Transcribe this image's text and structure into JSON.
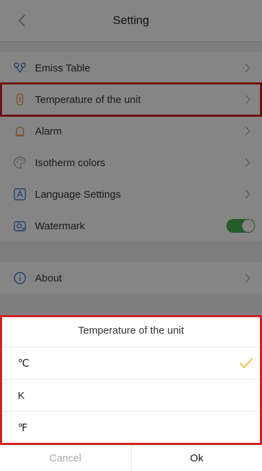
{
  "header": {
    "title": "Setting",
    "back_icon": "chevron-left-icon"
  },
  "settings": {
    "items": [
      {
        "label": "Emiss Table",
        "icon": "emissivity-icon",
        "trailing": "chevron"
      },
      {
        "label": "Temperature of the unit",
        "icon": "thermometer-icon",
        "trailing": "chevron"
      },
      {
        "label": "Alarm",
        "icon": "alarm-icon",
        "trailing": "chevron"
      },
      {
        "label": "Isotherm colors",
        "icon": "palette-icon",
        "trailing": "chevron"
      },
      {
        "label": "Language Settings",
        "icon": "language-icon",
        "trailing": "chevron"
      },
      {
        "label": "Watermark",
        "icon": "watermark-icon",
        "trailing": "toggle",
        "enabled": true
      },
      {
        "label": "About",
        "icon": "info-icon",
        "trailing": "chevron"
      }
    ]
  },
  "sheet": {
    "title": "Temperature of the unit",
    "options": [
      {
        "label": "℃",
        "selected": true
      },
      {
        "label": "K",
        "selected": false
      },
      {
        "label": "℉",
        "selected": false
      }
    ],
    "cancel_label": "Cancel",
    "ok_label": "Ok"
  },
  "colors": {
    "highlight": "#d01f1f",
    "toggle_on": "#4caf50",
    "check": "#f5b82e",
    "icon_blue": "#3b7dd8",
    "icon_orange": "#e8a24a"
  }
}
